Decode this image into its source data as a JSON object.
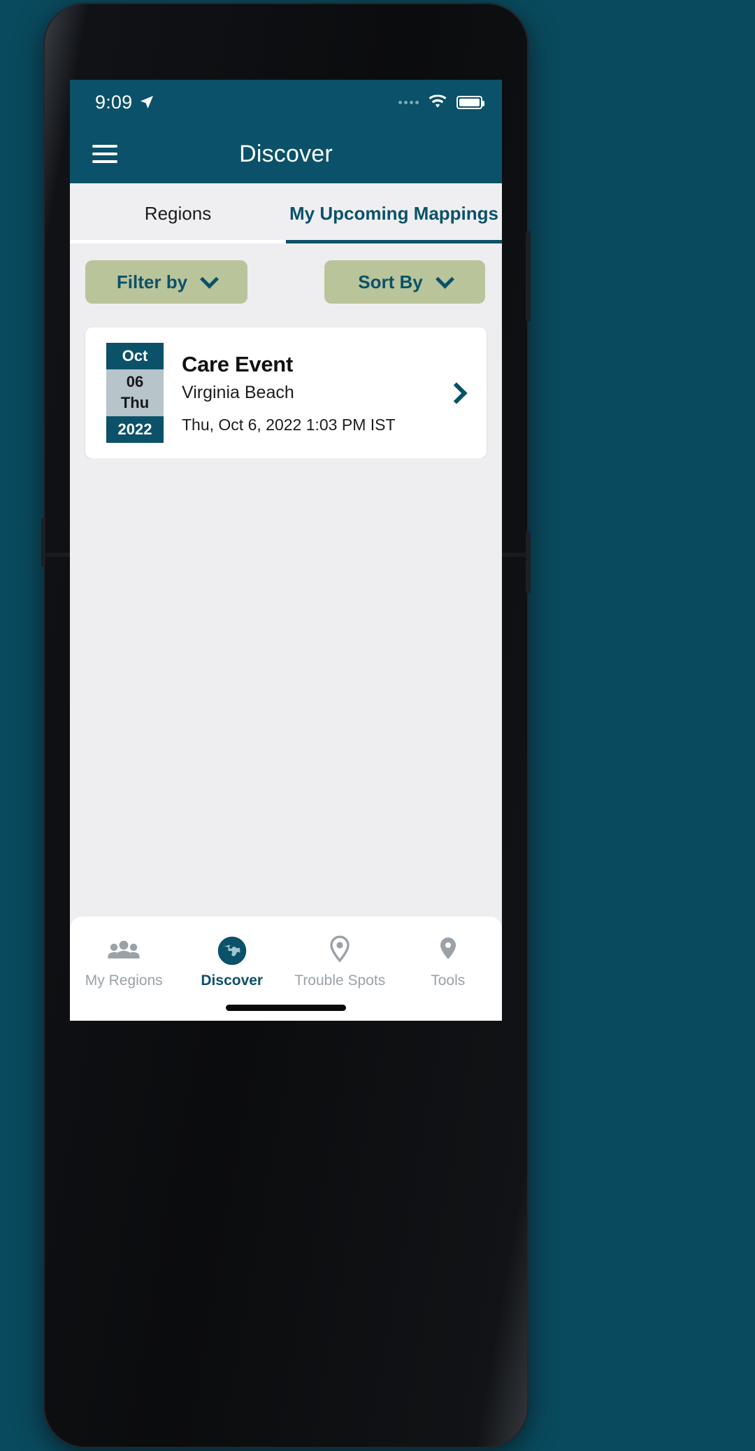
{
  "theme": {
    "brand_teal": "#0b5169",
    "sage": "#b9c49a",
    "screen_bg": "#eeeef0",
    "card_bg": "#ffffff",
    "date_mid": "#b7c4c9",
    "muted": "#9aa2a8",
    "outer_bg": "#0a4a5e"
  },
  "status_bar": {
    "time": "9:09",
    "location_icon": "location-arrow-icon",
    "signal_icon": "signal-dots-icon",
    "wifi_icon": "wifi-icon",
    "battery_icon": "battery-full-icon"
  },
  "app_bar": {
    "menu_icon": "hamburger-menu-icon",
    "title": "Discover"
  },
  "tabs": [
    {
      "label": "Regions",
      "active": false
    },
    {
      "label": "My Upcoming Mappings",
      "active": true
    }
  ],
  "controls": {
    "filter": {
      "label": "Filter by",
      "icon": "chevron-down-icon"
    },
    "sort": {
      "label": "Sort By",
      "icon": "chevron-down-icon"
    }
  },
  "events": [
    {
      "date_badge": {
        "month": "Oct",
        "day": "06",
        "weekday": "Thu",
        "year": "2022"
      },
      "title": "Care Event",
      "location": "Virginia Beach",
      "datetime": "Thu, Oct 6, 2022 1:03 PM IST",
      "chevron_icon": "chevron-right-icon"
    }
  ],
  "bottom_nav": [
    {
      "label": "My Regions",
      "icon": "people-group-icon",
      "active": false
    },
    {
      "label": "Discover",
      "icon": "globe-icon",
      "active": true
    },
    {
      "label": "Trouble Spots",
      "icon": "map-pin-icon",
      "active": false
    },
    {
      "label": "Tools",
      "icon": "map-pin-icon",
      "active": false
    }
  ],
  "home_indicator": "home-indicator-bar"
}
